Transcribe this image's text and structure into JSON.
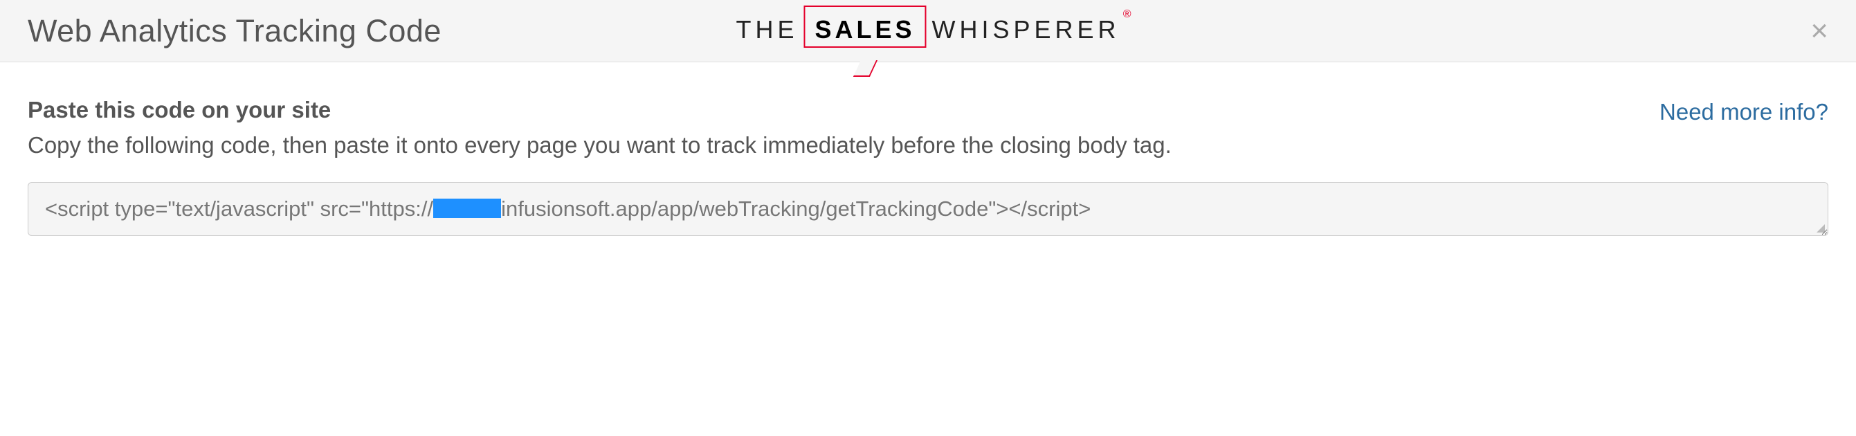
{
  "header": {
    "title": "Web Analytics Tracking Code",
    "logo": {
      "the": "THE",
      "sales": "SALES",
      "whisperer": "WHISPERER",
      "reg": "®"
    }
  },
  "main": {
    "heading": "Paste this code on your site",
    "description": "Copy the following code, then paste it onto every page you want to track immediately before the closing body tag.",
    "help_link": "Need more info?",
    "code_prefix": "<script type=\"text/javascript\" src=\"https://",
    "code_suffix": "infusionsoft.app/app/webTracking/getTrackingCode\"></script>"
  }
}
